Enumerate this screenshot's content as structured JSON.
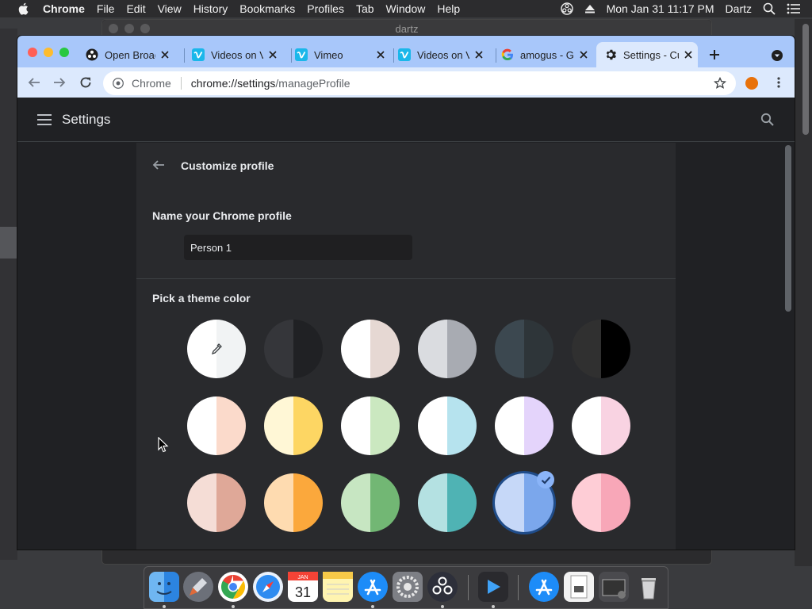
{
  "menubar": {
    "app_name": "Chrome",
    "menus": [
      "File",
      "Edit",
      "View",
      "History",
      "Bookmarks",
      "Profiles",
      "Tab",
      "Window",
      "Help"
    ],
    "clock": "Mon Jan 31  11:17 PM",
    "user": "Dartz"
  },
  "background_window": {
    "title": "dartz"
  },
  "tabs": [
    {
      "title": "Open Broadcaster",
      "icon": "obs-icon"
    },
    {
      "title": "Videos on Vimeo",
      "icon": "vimeo-icon"
    },
    {
      "title": "Vimeo",
      "icon": "vimeo-icon"
    },
    {
      "title": "Videos on Vimeo",
      "icon": "vimeo-icon"
    },
    {
      "title": "amogus - Google",
      "icon": "google-icon"
    },
    {
      "title": "Settings - Customize profile",
      "icon": "settings-gear-icon",
      "active": true
    }
  ],
  "omnibox": {
    "chip": "Chrome",
    "url_host": "chrome://settings",
    "url_path": "/manageProfile"
  },
  "settings": {
    "header_title": "Settings",
    "page_title": "Customize profile",
    "name_label": "Name your Chrome profile",
    "name_value": "Person 1",
    "theme_label": "Pick a theme color",
    "selected_theme_index": 16
  },
  "theme_colors": [
    {
      "left": "#ffffff",
      "right": "#f1f3f4",
      "custom": true
    },
    {
      "left": "#35363a",
      "right": "#202124"
    },
    {
      "left": "#ffffff",
      "right": "#e6d8d3"
    },
    {
      "left": "#dadce0",
      "right": "#a8abb2"
    },
    {
      "left": "#3c4850",
      "right": "#2e3539"
    },
    {
      "left": "#303030",
      "right": "#000000"
    },
    {
      "left": "#ffffff",
      "right": "#fbdacb"
    },
    {
      "left": "#fff7d6",
      "right": "#fdd663"
    },
    {
      "left": "#ffffff",
      "right": "#cbe8c0"
    },
    {
      "left": "#ffffff",
      "right": "#b6e3ee"
    },
    {
      "left": "#ffffff",
      "right": "#e4d4fb"
    },
    {
      "left": "#ffffff",
      "right": "#f9d3e2"
    },
    {
      "left": "#f5ddd6",
      "right": "#dfa898"
    },
    {
      "left": "#fedbb0",
      "right": "#fba83c"
    },
    {
      "left": "#c7e6c2",
      "right": "#72b774"
    },
    {
      "left": "#b4e1e2",
      "right": "#4fb3b4"
    },
    {
      "left": "#c6d8f8",
      "right": "#7ba7ec"
    },
    {
      "left": "#fecdd6",
      "right": "#f8a7b8"
    }
  ],
  "dock": {
    "apps": [
      "finder-icon",
      "launchpad-icon",
      "chrome-icon",
      "safari-icon",
      "calendar-icon",
      "notes-icon",
      "app-store-icon",
      "system-preferences-icon",
      "obs-icon",
      "infuse-icon",
      "app-store-folder-icon",
      "document-icon",
      "screenshot-icon",
      "trash-icon"
    ]
  }
}
